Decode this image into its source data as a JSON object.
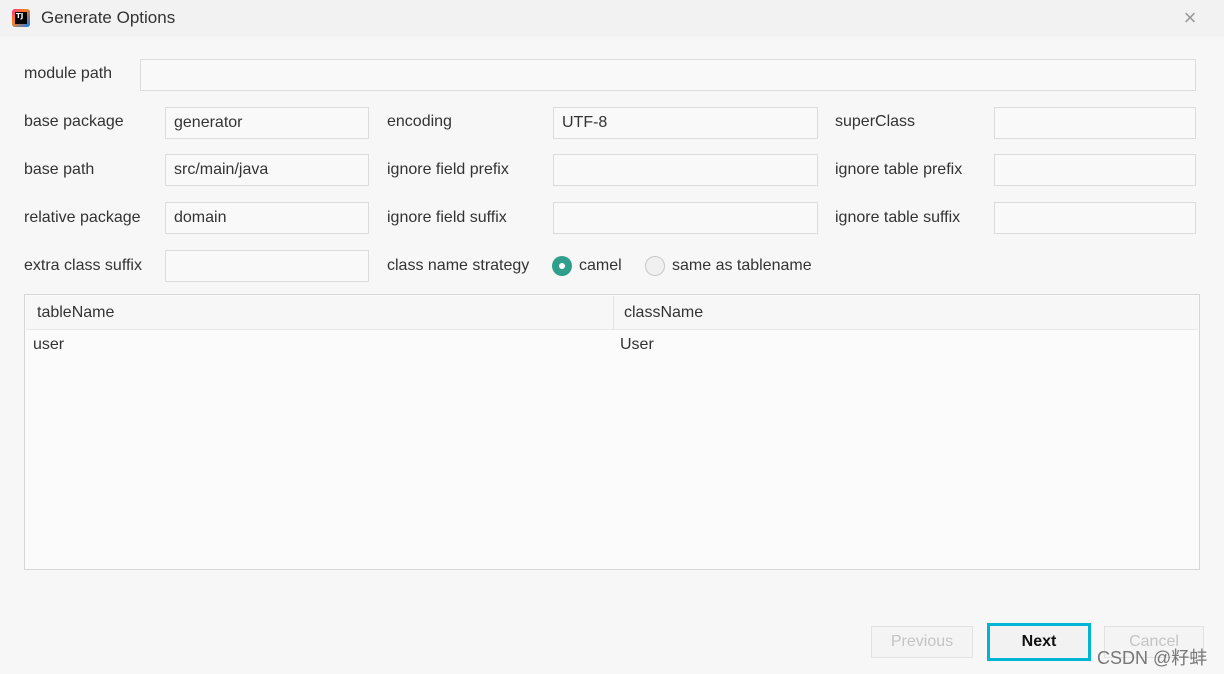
{
  "window": {
    "title": "Generate Options",
    "app_icon_text": "TJ"
  },
  "form": {
    "module_path": {
      "label": "module path",
      "value": ""
    },
    "base_package": {
      "label": "base package",
      "value": "generator"
    },
    "encoding": {
      "label": "encoding",
      "value": "UTF-8"
    },
    "super_class": {
      "label": "superClass",
      "value": ""
    },
    "base_path": {
      "label": "base path",
      "value": "src/main/java"
    },
    "ignore_field_prefix": {
      "label": "ignore field prefix",
      "value": ""
    },
    "ignore_table_prefix": {
      "label": "ignore table prefix",
      "value": ""
    },
    "relative_package": {
      "label": "relative package",
      "value": "domain"
    },
    "ignore_field_suffix": {
      "label": "ignore field suffix",
      "value": ""
    },
    "ignore_table_suffix": {
      "label": "ignore table suffix",
      "value": ""
    },
    "extra_class_suffix": {
      "label": "extra class suffix",
      "value": ""
    },
    "class_name_strategy": {
      "label": "class name strategy",
      "options": [
        "camel",
        "same as tablename"
      ],
      "selected": "camel"
    }
  },
  "table": {
    "columns": [
      "tableName",
      "className"
    ],
    "rows": [
      [
        "user",
        "User"
      ]
    ]
  },
  "buttons": {
    "previous": "Previous",
    "next": "Next",
    "cancel": "Cancel"
  },
  "watermark": "CSDN @籽蚌",
  "colors": {
    "accent": "#2f9f8c",
    "focus_border": "#00b4d4"
  }
}
